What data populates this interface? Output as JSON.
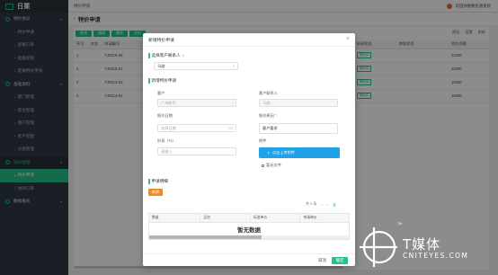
{
  "app": {
    "name": "日栗"
  },
  "sidebar": {
    "items": [
      {
        "label": "特价协议",
        "kind": "group"
      },
      {
        "label": "特价申请",
        "kind": "sub"
      },
      {
        "label": "套餐订单",
        "kind": "sub"
      },
      {
        "label": "套餐促销",
        "kind": "sub"
      },
      {
        "label": "套餐特价申请",
        "kind": "sub"
      },
      {
        "label": "基础资料",
        "kind": "group"
      },
      {
        "label": "部门管理",
        "kind": "sub"
      },
      {
        "label": "职位管理",
        "kind": "sub"
      },
      {
        "label": "用户管理",
        "kind": "sub"
      },
      {
        "label": "客户管理",
        "kind": "sub"
      },
      {
        "label": "分类管理",
        "kind": "sub"
      },
      {
        "label": "协价管理",
        "kind": "group-active"
      },
      {
        "label": "特价申请",
        "kind": "active"
      },
      {
        "label": "协商订单",
        "kind": "sub"
      },
      {
        "label": "数据报表",
        "kind": "group"
      }
    ]
  },
  "header": {
    "breadcrumb": "特价申请",
    "user": "日田钟维数智通系统"
  },
  "page": {
    "title": "特价申请",
    "toolbar": [
      "新增",
      "编辑",
      "删除",
      "导出"
    ],
    "tools_right": [
      "筛选",
      "设置",
      "刷新"
    ],
    "table": {
      "headers": [
        "序号",
        "状态",
        "申请编号",
        "",
        "申请日期",
        "申请状态",
        "审批状态",
        "特价金额"
      ],
      "rows": [
        [
          "1",
          "",
          "TJ0215-08",
          "",
          "2020-05-14",
          "审批中",
          "",
          "21000"
        ],
        [
          "2",
          "",
          "TJ0215-01",
          "",
          "2020-05-14",
          "审批中",
          "",
          "22000"
        ],
        [
          "3",
          "",
          "TJ0214-03",
          "",
          "2020-05-14",
          "审批中",
          "",
          "15000"
        ],
        [
          "4",
          "",
          "TJ0214-02",
          "",
          "2020-05-14",
          "审批中",
          "",
          "15000"
        ]
      ]
    }
  },
  "modal": {
    "title": "新增特价申请",
    "close": "×",
    "section_contact": {
      "title": "选择客户联系人",
      "required": "*"
    },
    "contact_value": "马勋",
    "section_info": {
      "title": "新增特价申请"
    },
    "fields": {
      "customer": {
        "label": "客户",
        "value": "广州新华"
      },
      "customer_contact": {
        "label": "客户联系人",
        "value": "马勋"
      },
      "quote_date": {
        "label": "报价日期",
        "placeholder": "选择日期"
      },
      "reason": {
        "label": "报价原因",
        "required": "*",
        "value": "客户要求"
      },
      "discount": {
        "label": "折扣（%）",
        "placeholder": "请输入"
      },
      "attachment": {
        "label": "附件",
        "upload": "点击上传附件",
        "none": "暂无文件"
      }
    },
    "section_detail": {
      "title": "申请明细"
    },
    "add_button": "新增",
    "pager": {
      "range": "共 0 条",
      "prev": "‹",
      "next": "›"
    },
    "grid": {
      "headers": [
        "数量",
        "品名",
        "标准单价",
        "申请单价"
      ],
      "empty": "暂无数据"
    },
    "cancel": "取消",
    "ok": "确定"
  },
  "watermark": {
    "brand": "T媒体",
    "domain": "CNITEYES.COM",
    "tm": "TM"
  },
  "colors": {
    "accent": "#27c08c",
    "upload": "#1fa2e8",
    "add": "#f08a24",
    "sidebar": "#2f3a44"
  }
}
